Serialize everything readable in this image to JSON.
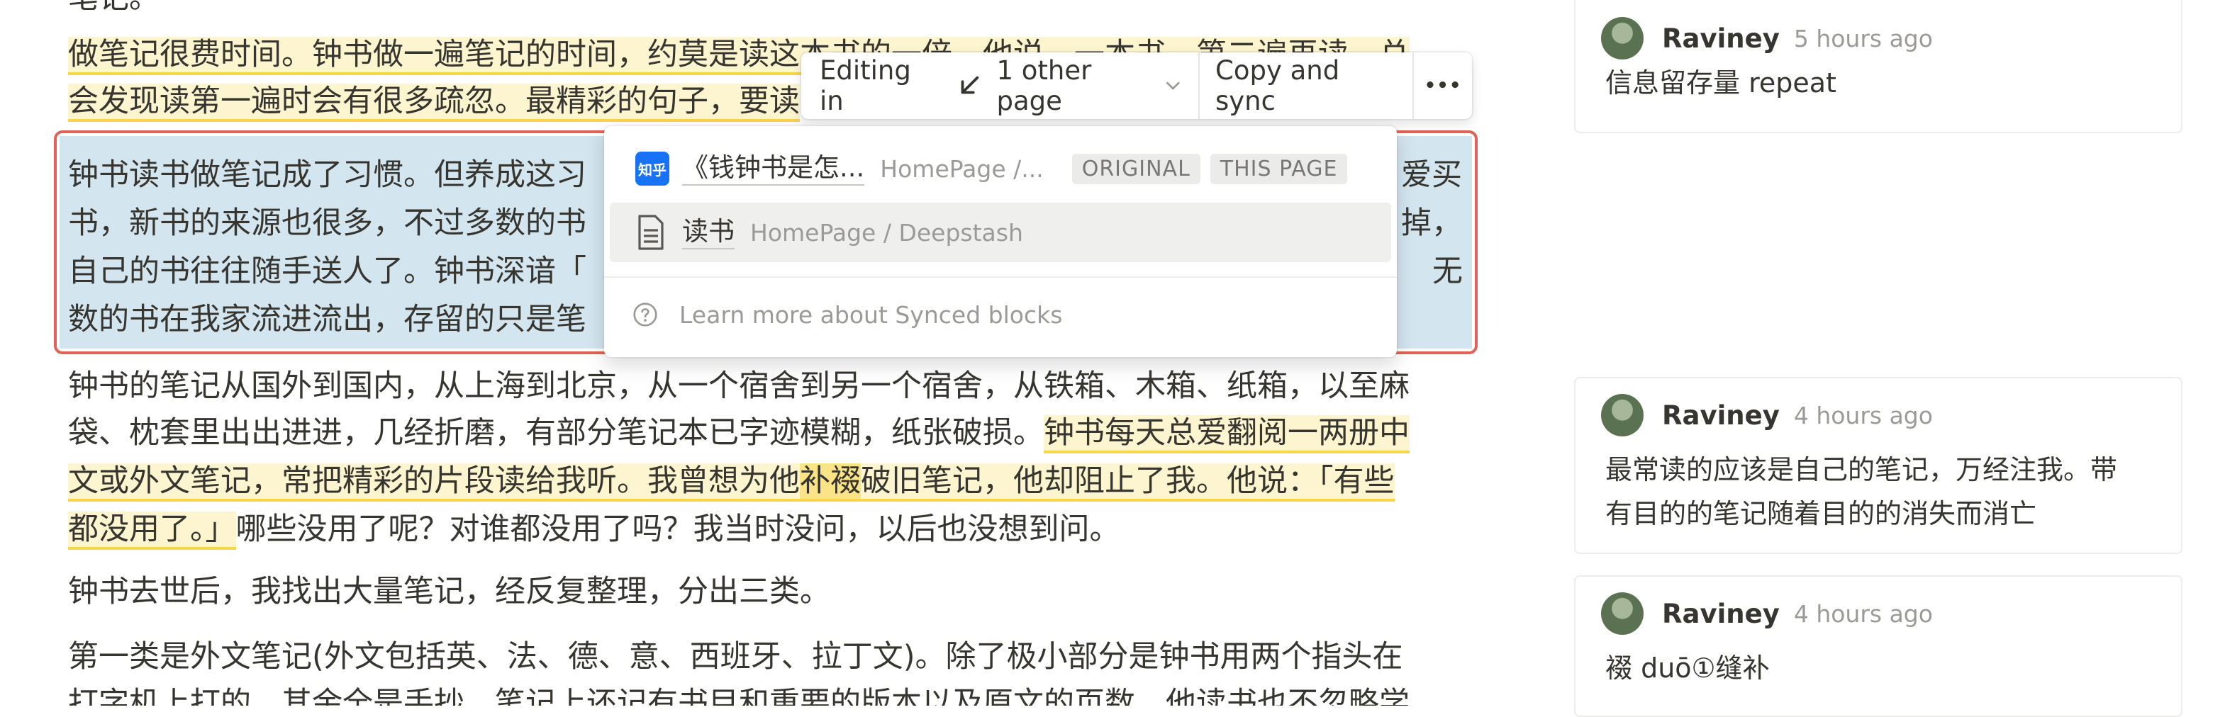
{
  "document": {
    "top_partial": "笔记。",
    "paragraph1": {
      "line1": "做笔记很费时间。钟书做一遍笔记的时间，约莫是读这本书的一倍。他说，一本书，第二遍再读，总",
      "line2": "会发现读第一遍时会有很多疏忽。最精彩的句子，要读"
    },
    "synced_block": {
      "line1_left": "钟书读书做笔记成了习惯。但养成这习",
      "line1_right": "爱买",
      "line2_left": "书，新书的来源也很多，不过多数的书",
      "line2_right": "掉，",
      "line3_left": "自己的书往往随手送人了。钟书深谙「",
      "line3_right": "无",
      "line4_left": "数的书在我家流进流出，存留的只是笔"
    },
    "paragraph3": {
      "line1": "钟书的笔记从国外到国内，从上海到北京，从一个宿舍到另一个宿舍，从铁箱、木箱、纸箱，以至麻",
      "line2_plain": "袋、枕套里出出进进，几经折磨，有部分笔记本已字迹模糊，纸张破损。",
      "line2_hl": "钟书每天总爱翻阅一两册中",
      "line3_hl_a": "文或外文笔记，常把精彩的片段读给我听。我曾想为他",
      "line3_hl_strong": "补裰",
      "line3_hl_b": "破旧笔记，他却阻止了我。他说：「有些",
      "line4_hl": "都没用了。」",
      "line4_plain": "哪些没用了呢？对谁都没用了吗？我当时没问，以后也没想到问。"
    },
    "paragraph4": "钟书去世后，我找出大量笔记，经反复整理，分出三类。",
    "paragraph5": {
      "line1": "第一类是外文笔记(外文包括英、法、德、意、西班牙、拉丁文)。除了极小部分是钟书用两个指头在",
      "line2": "打字机上打的，其余全是手抄。笔记上还记有书目和重要的版本以及原文的页数。他读书也不忽略学"
    }
  },
  "sync_toolbar": {
    "editing_label": "Editing in",
    "pages_label": "1 other page",
    "copy_label": "Copy and sync",
    "more_label": "•••"
  },
  "pages_dropdown": {
    "items": [
      {
        "logo": "知乎",
        "title": "《钱钟书是怎...",
        "path": "HomePage /...",
        "badges": [
          "ORIGINAL",
          "THIS PAGE"
        ]
      },
      {
        "title": "读书",
        "path": "HomePage / Deepstash"
      }
    ],
    "learn_more": "Learn more about Synced blocks"
  },
  "comments": [
    {
      "author": "Raviney",
      "time": "5 hours ago",
      "lines": [
        "信息留存量 repeat"
      ]
    },
    {
      "author": "Raviney",
      "time": "4 hours ago",
      "lines": [
        "最常读的应该是自己的笔记，万经注我。带",
        "有目的的笔记随着目的的消失而消亡"
      ]
    },
    {
      "author": "Raviney",
      "time": "4 hours ago",
      "lines": [
        "裰 duō①缝补"
      ]
    }
  ],
  "colors": {
    "synced_border": "#e16259",
    "synced_fill": "#d3e5ef",
    "highlight": "#fdf5cf",
    "highlight_underline": "#f7d64a"
  }
}
